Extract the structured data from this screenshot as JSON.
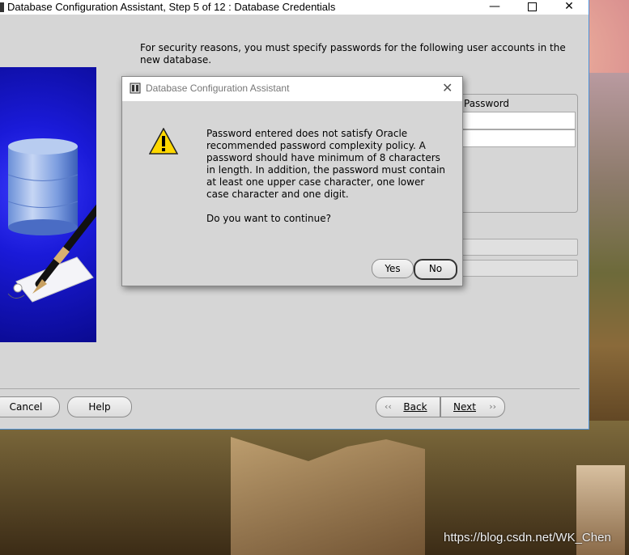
{
  "window": {
    "title": "Database Configuration Assistant, Step 5 of 12 : Database Credentials",
    "minimize": "—",
    "close": "✕"
  },
  "instructions": "For security reasons, you must specify passwords for the following user accounts in the new database.",
  "table": {
    "password_header": "Password"
  },
  "buttons": {
    "cancel": "Cancel",
    "help": "Help",
    "back": "Back",
    "next": "Next"
  },
  "dialog": {
    "title": "Database Configuration Assistant",
    "close": "✕",
    "message": "Password entered does not satisfy Oracle recommended password complexity policy. A password should have minimum of 8 characters in length. In addition, the password must contain at least one upper case character, one lower case character and one digit.\n\nDo you want to continue?",
    "yes": "Yes",
    "no": "No",
    "icon": "warning-icon"
  },
  "watermark": "https://blog.csdn.net/WK_Chen",
  "colors": {
    "side_panel": "#1a1ad8",
    "dialog_bg": "#d6d6d6",
    "warning": "#ffd800"
  }
}
